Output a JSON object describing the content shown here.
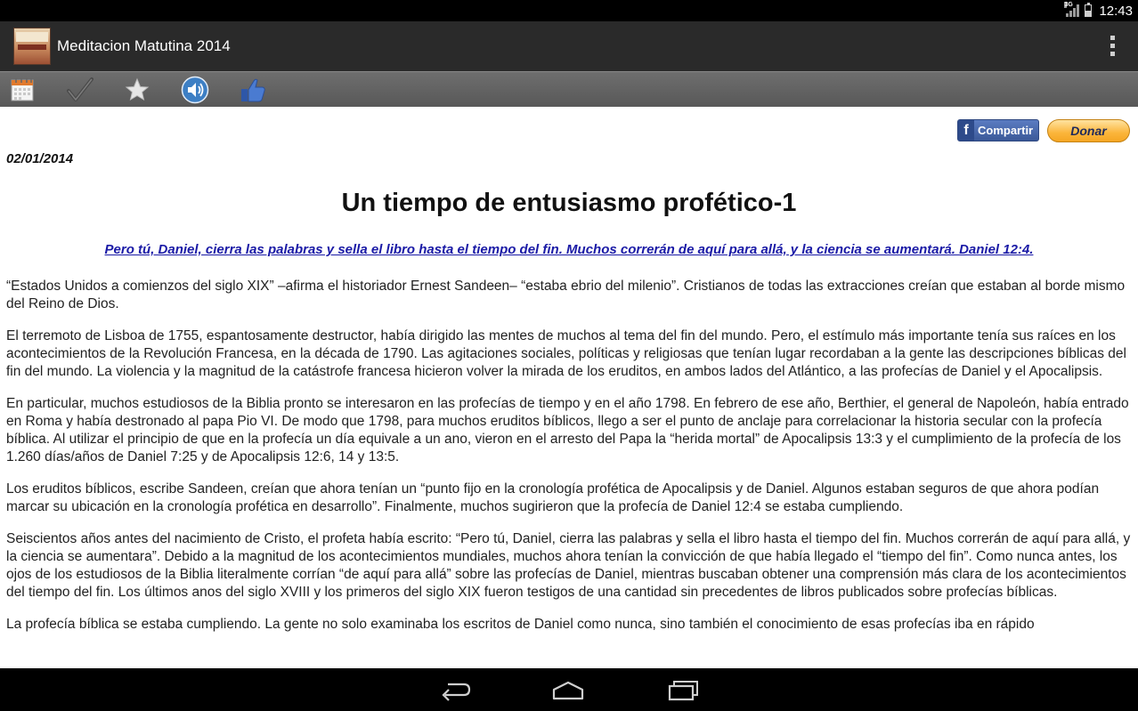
{
  "status_bar": {
    "network": "3G",
    "time": "12:43"
  },
  "action_bar": {
    "app_title": "Meditacion Matutina 2014",
    "app_icon": "book-cover-icon",
    "overflow_icon": "overflow-menu-icon"
  },
  "toolbar": {
    "icons": [
      "calendar-icon",
      "checkmark-icon",
      "star-icon",
      "speaker-icon",
      "thumbs-up-icon"
    ]
  },
  "content": {
    "share_label": "Compartir",
    "share_fb_glyph": "f",
    "donate_label": "Donar",
    "date": "02/01/2014",
    "title": "Un tiempo de entusiasmo profético-1",
    "verse": "Pero tú, Daniel, cierra las palabras y sella el libro hasta el tiempo del fin. Muchos correrán de aquí para allá, y la ciencia se aumentará. Daniel 12:4.",
    "paragraphs": [
      "“Estados Unidos a comienzos del siglo XIX” –afirma el historiador Ernest Sandeen– “estaba ebrio del milenio”. Cristianos de todas las extracciones creían que estaban al borde mismo del Reino de Dios.",
      "El terremoto de Lisboa de 1755, espantosamente destructor, había dirigido las mentes de muchos al tema del fin del mundo. Pero, el estímulo más importante tenía sus raíces en los acontecimientos de la Revolución Francesa, en la década de 1790. Las agitaciones sociales, políticas y religiosas que tenían lugar recordaban a la gente las descripciones bíblicas del fin del mundo. La violencia y la magnitud de la catástrofe francesa hicieron volver la mirada de los eruditos, en ambos lados del Atlántico, a las profecías de Daniel y el Apocalipsis.",
      "En particular, muchos estudiosos de la Biblia pronto se interesaron en las profecías de tiempo y en el año 1798. En febrero de ese año, Berthier, el general de Napoleón, había entrado en Roma y había destronado al papa Pio VI. De modo que 1798, para muchos eruditos bíblicos, llego a ser el punto de anclaje para correlacionar la historia secular con la profecía bíblica. Al utilizar el principio de que en la profecía un día equivale a un ano, vieron en el arresto del Papa la “herida mortal” de Apocalipsis 13:3 y el cumplimiento de la profecía de los 1.260 días/años de Daniel 7:25 y de Apocalipsis 12:6, 14 y 13:5.",
      "Los eruditos bíblicos, escribe Sandeen, creían que ahora tenían un “punto fijo en la cronología profética de Apocalipsis y de Daniel. Algunos estaban seguros de que ahora podían marcar su ubicación en la cronología profética en desarrollo”. Finalmente, muchos sugirieron que la profecía de Daniel 12:4 se estaba cumpliendo.",
      "Seiscientos años antes del nacimiento de Cristo, el profeta había escrito: “Pero tú, Daniel, cierra las palabras y sella el libro hasta el tiempo del fin. Muchos correrán de aquí para allá, y la ciencia se aumentara”. Debido a la magnitud de los acontecimientos mundiales, muchos ahora tenían la convicción de que había llegado el “tiempo del fin”. Como nunca antes, los ojos de los estudiosos de la Biblia literalmente corrían “de aquí para allá” sobre las profecías de Daniel, mientras buscaban obtener una comprensión más clara de los acontecimientos del tiempo del fin. Los últimos anos del siglo XVIII y los primeros del siglo XIX fueron testigos de una cantidad sin precedentes de libros publicados sobre profecías bíblicas.",
      "La profecía bíblica se estaba cumpliendo. La gente no solo examinaba los escritos de Daniel como nunca, sino también el conocimiento de esas profecías iba en rápido"
    ]
  },
  "nav_bar": {
    "icons": [
      "back-icon",
      "home-icon",
      "recent-apps-icon"
    ]
  }
}
